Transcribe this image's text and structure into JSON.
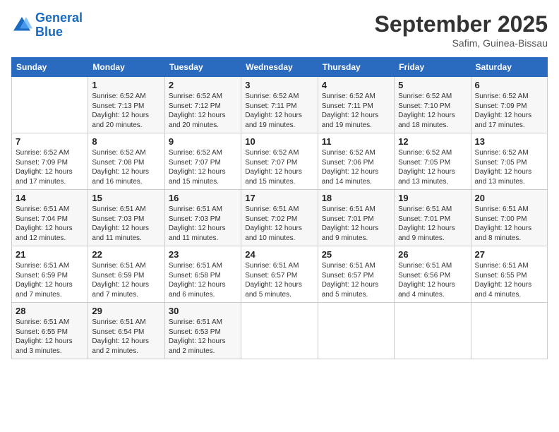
{
  "header": {
    "logo_line1": "General",
    "logo_line2": "Blue",
    "month": "September 2025",
    "location": "Safim, Guinea-Bissau"
  },
  "weekdays": [
    "Sunday",
    "Monday",
    "Tuesday",
    "Wednesday",
    "Thursday",
    "Friday",
    "Saturday"
  ],
  "weeks": [
    [
      {
        "day": "",
        "info": ""
      },
      {
        "day": "1",
        "info": "Sunrise: 6:52 AM\nSunset: 7:13 PM\nDaylight: 12 hours\nand 20 minutes."
      },
      {
        "day": "2",
        "info": "Sunrise: 6:52 AM\nSunset: 7:12 PM\nDaylight: 12 hours\nand 20 minutes."
      },
      {
        "day": "3",
        "info": "Sunrise: 6:52 AM\nSunset: 7:11 PM\nDaylight: 12 hours\nand 19 minutes."
      },
      {
        "day": "4",
        "info": "Sunrise: 6:52 AM\nSunset: 7:11 PM\nDaylight: 12 hours\nand 19 minutes."
      },
      {
        "day": "5",
        "info": "Sunrise: 6:52 AM\nSunset: 7:10 PM\nDaylight: 12 hours\nand 18 minutes."
      },
      {
        "day": "6",
        "info": "Sunrise: 6:52 AM\nSunset: 7:09 PM\nDaylight: 12 hours\nand 17 minutes."
      }
    ],
    [
      {
        "day": "7",
        "info": "Sunrise: 6:52 AM\nSunset: 7:09 PM\nDaylight: 12 hours\nand 17 minutes."
      },
      {
        "day": "8",
        "info": "Sunrise: 6:52 AM\nSunset: 7:08 PM\nDaylight: 12 hours\nand 16 minutes."
      },
      {
        "day": "9",
        "info": "Sunrise: 6:52 AM\nSunset: 7:07 PM\nDaylight: 12 hours\nand 15 minutes."
      },
      {
        "day": "10",
        "info": "Sunrise: 6:52 AM\nSunset: 7:07 PM\nDaylight: 12 hours\nand 15 minutes."
      },
      {
        "day": "11",
        "info": "Sunrise: 6:52 AM\nSunset: 7:06 PM\nDaylight: 12 hours\nand 14 minutes."
      },
      {
        "day": "12",
        "info": "Sunrise: 6:52 AM\nSunset: 7:05 PM\nDaylight: 12 hours\nand 13 minutes."
      },
      {
        "day": "13",
        "info": "Sunrise: 6:52 AM\nSunset: 7:05 PM\nDaylight: 12 hours\nand 13 minutes."
      }
    ],
    [
      {
        "day": "14",
        "info": "Sunrise: 6:51 AM\nSunset: 7:04 PM\nDaylight: 12 hours\nand 12 minutes."
      },
      {
        "day": "15",
        "info": "Sunrise: 6:51 AM\nSunset: 7:03 PM\nDaylight: 12 hours\nand 11 minutes."
      },
      {
        "day": "16",
        "info": "Sunrise: 6:51 AM\nSunset: 7:03 PM\nDaylight: 12 hours\nand 11 minutes."
      },
      {
        "day": "17",
        "info": "Sunrise: 6:51 AM\nSunset: 7:02 PM\nDaylight: 12 hours\nand 10 minutes."
      },
      {
        "day": "18",
        "info": "Sunrise: 6:51 AM\nSunset: 7:01 PM\nDaylight: 12 hours\nand 9 minutes."
      },
      {
        "day": "19",
        "info": "Sunrise: 6:51 AM\nSunset: 7:01 PM\nDaylight: 12 hours\nand 9 minutes."
      },
      {
        "day": "20",
        "info": "Sunrise: 6:51 AM\nSunset: 7:00 PM\nDaylight: 12 hours\nand 8 minutes."
      }
    ],
    [
      {
        "day": "21",
        "info": "Sunrise: 6:51 AM\nSunset: 6:59 PM\nDaylight: 12 hours\nand 7 minutes."
      },
      {
        "day": "22",
        "info": "Sunrise: 6:51 AM\nSunset: 6:59 PM\nDaylight: 12 hours\nand 7 minutes."
      },
      {
        "day": "23",
        "info": "Sunrise: 6:51 AM\nSunset: 6:58 PM\nDaylight: 12 hours\nand 6 minutes."
      },
      {
        "day": "24",
        "info": "Sunrise: 6:51 AM\nSunset: 6:57 PM\nDaylight: 12 hours\nand 5 minutes."
      },
      {
        "day": "25",
        "info": "Sunrise: 6:51 AM\nSunset: 6:57 PM\nDaylight: 12 hours\nand 5 minutes."
      },
      {
        "day": "26",
        "info": "Sunrise: 6:51 AM\nSunset: 6:56 PM\nDaylight: 12 hours\nand 4 minutes."
      },
      {
        "day": "27",
        "info": "Sunrise: 6:51 AM\nSunset: 6:55 PM\nDaylight: 12 hours\nand 4 minutes."
      }
    ],
    [
      {
        "day": "28",
        "info": "Sunrise: 6:51 AM\nSunset: 6:55 PM\nDaylight: 12 hours\nand 3 minutes."
      },
      {
        "day": "29",
        "info": "Sunrise: 6:51 AM\nSunset: 6:54 PM\nDaylight: 12 hours\nand 2 minutes."
      },
      {
        "day": "30",
        "info": "Sunrise: 6:51 AM\nSunset: 6:53 PM\nDaylight: 12 hours\nand 2 minutes."
      },
      {
        "day": "",
        "info": ""
      },
      {
        "day": "",
        "info": ""
      },
      {
        "day": "",
        "info": ""
      },
      {
        "day": "",
        "info": ""
      }
    ]
  ]
}
